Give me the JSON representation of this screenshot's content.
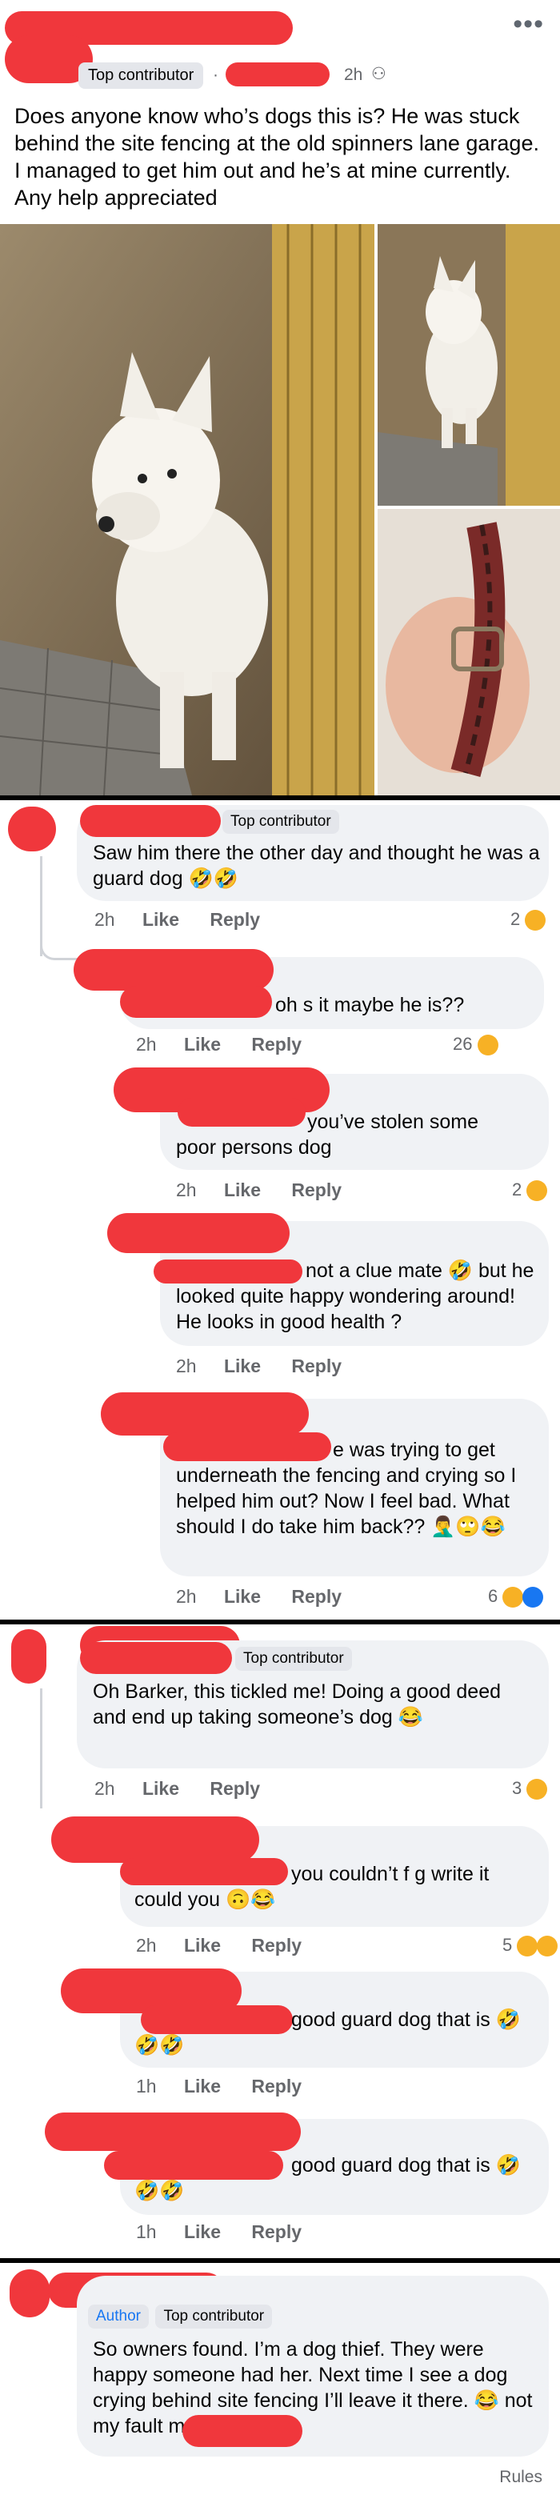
{
  "post": {
    "badge": "Top contributor",
    "time": "2h",
    "dot": "·",
    "globe_icon": "friends-icon",
    "more_icon": "•••",
    "text": "Does anyone know who’s dogs this is? He was stuck behind the site fencing at the old spinners lane garage. I managed to get him out and he’s at mine currently. Any help appreciated"
  },
  "threads": [
    {
      "badge": "Top contributor",
      "text": "Saw him there the other day and thought he was a guard dog 🤣🤣",
      "time": "2h",
      "like": "Like",
      "reply": "Reply",
      "count": "2",
      "replies": [
        {
          "text": "oh s  it maybe he is??",
          "time": "2h",
          "like": "Like",
          "reply": "Reply",
          "count": "26"
        },
        {
          "text": "you’ve stolen some poor persons dog",
          "time": "2h",
          "like": "Like",
          "reply": "Reply",
          "count": "2"
        },
        {
          "text": "not a clue mate 🤣 but he looked quite happy wondering around! He looks in good health ?",
          "time": "2h",
          "like": "Like",
          "reply": "Reply",
          "count": ""
        },
        {
          "text": "e was trying to get underneath the fencing and crying so I helped him out? Now I feel bad. What should I do take him back?? 🤦‍♂️🙄😂",
          "time": "2h",
          "like": "Like",
          "reply": "Reply",
          "count": "6"
        }
      ]
    },
    {
      "badge": "Top contributor",
      "text": "Oh Barker, this tickled me! Doing a good deed and end up taking someone’s dog 😂",
      "time": "2h",
      "like": "Like",
      "reply": "Reply",
      "count": "3",
      "replies": [
        {
          "text": "you couldn’t f        g write it could you 🙃😂",
          "time": "2h",
          "like": "Like",
          "reply": "Reply",
          "count": "5"
        },
        {
          "text": "good guard dog that is 🤣🤣🤣",
          "time": "1h",
          "like": "Like",
          "reply": "Reply",
          "count": ""
        },
        {
          "text": "good guard dog that is 🤣🤣🤣",
          "time": "1h",
          "like": "Like",
          "reply": "Reply",
          "count": ""
        }
      ]
    },
    {
      "author": "Author",
      "badge": "Top contributor",
      "text": "So owners found. I’m a dog thief. They were happy someone had her. Next time I see a dog crying behind site fencing I’ll leave it there. 😂                not my fault mate.. 👏"
    }
  ],
  "footer": {
    "rules": "Rules"
  },
  "colors": {
    "redaction": "#f0373c",
    "bubble": "#f0f2f5",
    "meta": "#65676b",
    "link_blue": "#1877f2"
  }
}
